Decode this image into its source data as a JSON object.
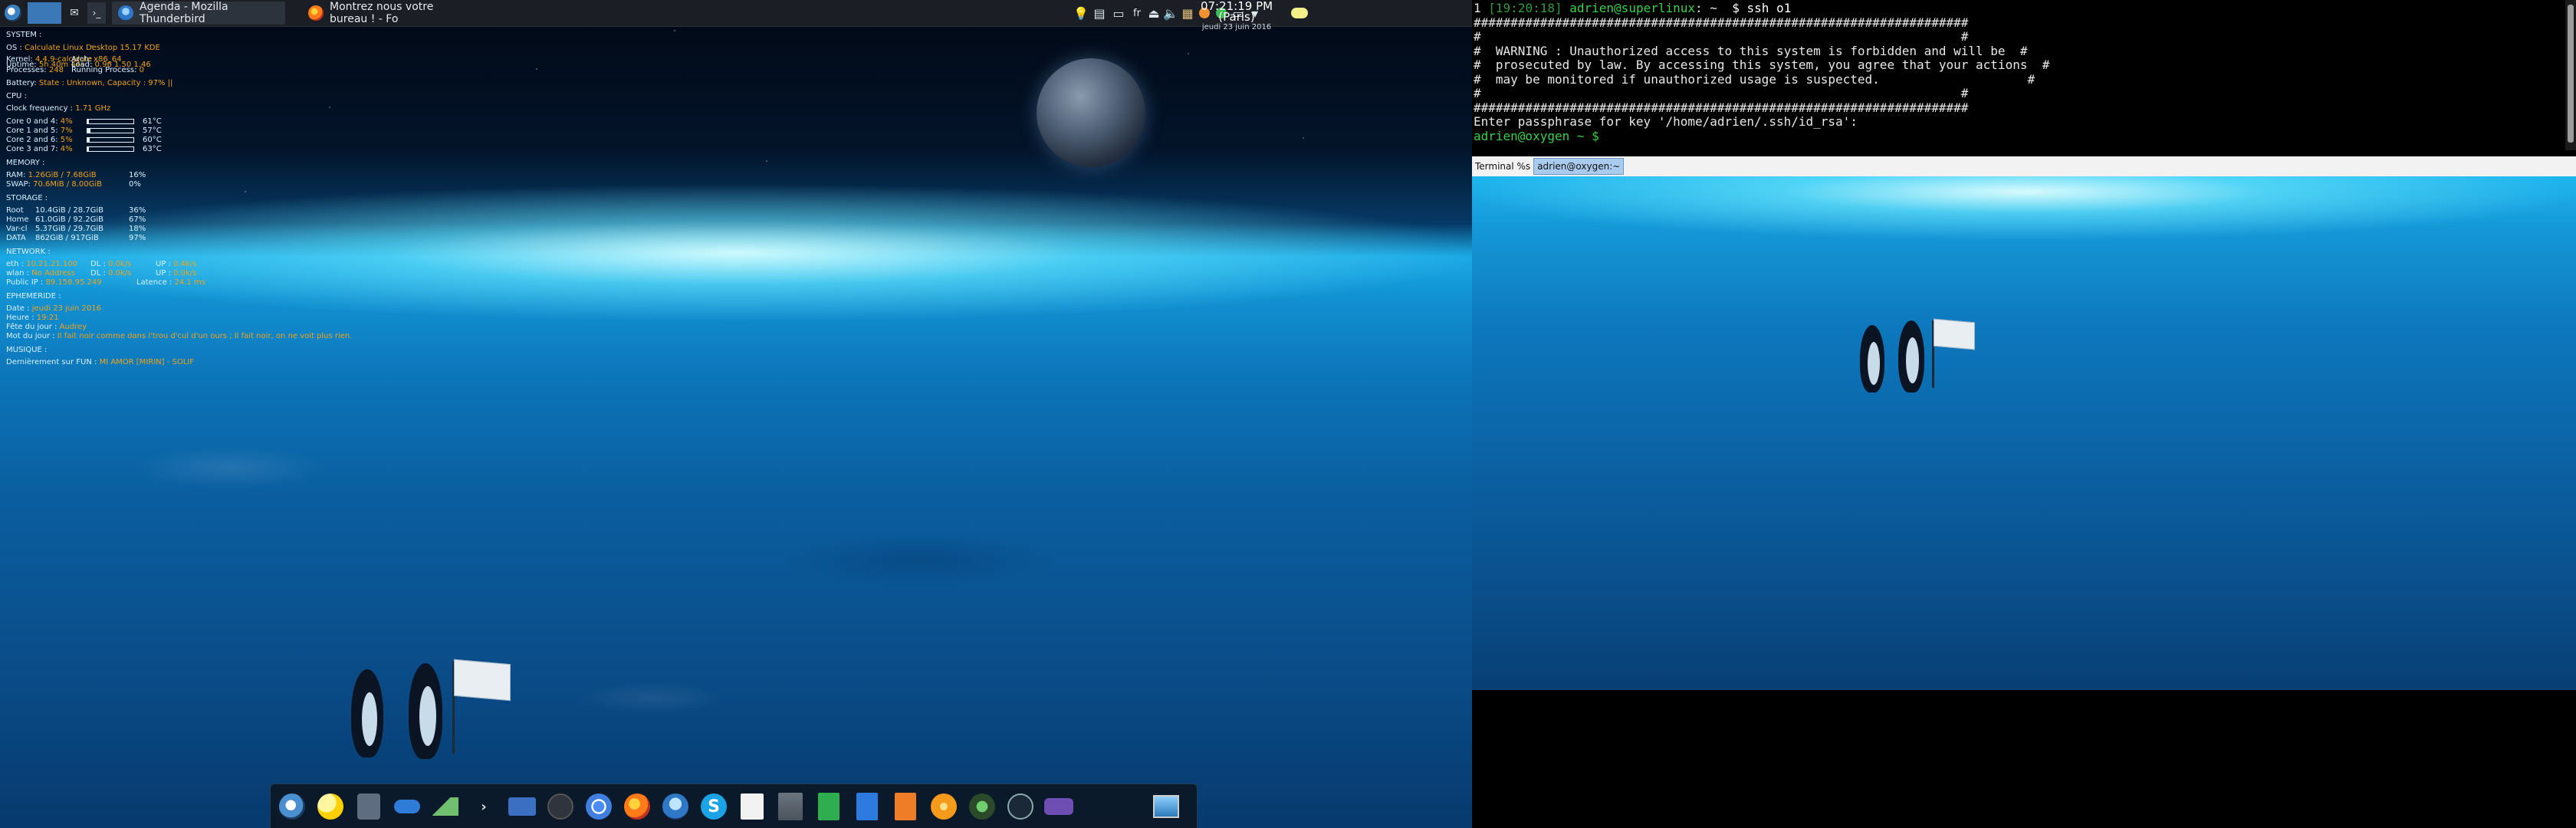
{
  "top_panel": {
    "tasks": [
      {
        "label": "Agenda - Mozilla Thunderbird"
      },
      {
        "label": "Montrez nous votre bureau ! - Fo"
      }
    ],
    "clock": {
      "time": "07:21:19 PM (Paris)",
      "date": "jeudi 23 juin 2016"
    }
  },
  "conky": {
    "system_header": "SYSTEM :",
    "os_label": "OS :",
    "os_value": "Calculate Linux Desktop 15.17 KDE",
    "kernel_label": "Kernel:",
    "kernel_value": "4.4.9-calculate",
    "arch_label": "Arch:",
    "arch_value": "x86_64",
    "uptime_label": "Uptime:",
    "uptime_value": "5h 40m 44s",
    "load_label": "Load:",
    "load_value": "0.96 1.50 1.46",
    "processes_label": "Processes:",
    "processes_value": "248",
    "running_label": "Running Process:",
    "running_value": "0",
    "battery_label": "Battery:",
    "battery_value": "State : Unknown, Capacity : 97% ||",
    "cpu_header": "CPU :",
    "clock_label": "Clock frequency :",
    "clock_value": "1.71 GHz",
    "cores": [
      {
        "label": "Core 0 and 4:",
        "pct": "4%",
        "temp": "61°C",
        "level": 0.04
      },
      {
        "label": "Core 1 and 5:",
        "pct": "7%",
        "temp": "57°C",
        "level": 0.07
      },
      {
        "label": "Core 2 and 6:",
        "pct": "5%",
        "temp": "60°C",
        "level": 0.05
      },
      {
        "label": "Core 3 and 7:",
        "pct": "4%",
        "temp": "63°C",
        "level": 0.04
      }
    ],
    "memory_header": "MEMORY :",
    "ram_label": "RAM:",
    "ram_value": "1.26GiB / 7.68GiB",
    "ram_pct": "16%",
    "swap_label": "SWAP:",
    "swap_value": "70.6MiB / 8.00GiB",
    "swap_pct": "0%",
    "storage_header": "STORAGE :",
    "storage": [
      {
        "label": "Root",
        "value": "10.4GiB / 28.7GiB",
        "pct": "36%"
      },
      {
        "label": "Home",
        "value": "61.0GiB / 92.2GiB",
        "pct": "67%"
      },
      {
        "label": "Var-cl",
        "value": "5.37GiB / 29.7GiB",
        "pct": "18%"
      },
      {
        "label": "DATA",
        "value": "862GiB / 917GiB",
        "pct": "97%"
      }
    ],
    "network_header": "NETWORK :",
    "eth_label": "eth :",
    "eth_value": "10.21.21.100",
    "eth_dl_label": "DL :",
    "eth_dl_value": "0.0k/s",
    "eth_up_label": "UP :",
    "eth_up_value": "0.4k/s",
    "wlan_label": "wlan :",
    "wlan_value": "No Address",
    "wlan_dl_label": "DL :",
    "wlan_dl_value": "0.0k/s",
    "wlan_up_label": "UP :",
    "wlan_up_value": "0.0k/s",
    "public_ip_label": "Public IP :",
    "public_ip_value": "89.158.95.249",
    "latency_label": "Latence :",
    "latency_value": "24.1 ms",
    "ephemeride_header": "EPHEMERIDE :",
    "date_label": "Date :",
    "date_value": "jeudi 23 juin 2016",
    "heure_label": "Heure :",
    "heure_value": "19:21",
    "fete_label": "Fête du jour :",
    "fete_value": "Audrey",
    "mot_label": "Mot du jour :",
    "mot_value": "Il fait noir comme dans l'trou d'cul d'un ours ; Il fait noir, on ne voit plus rien.",
    "musique_header": "MUSIQUE :",
    "fun_label": "Dernièrement sur FUN :",
    "fun_value": "MI AMOR [MIRIN] - SOLIF"
  },
  "terminal": {
    "prompt1_num": "1",
    "prompt1_time": "[19:20:18]",
    "prompt1_user": "adrien@superlinux",
    "prompt1_path": "~",
    "prompt1_cmd": "$ ssh o1",
    "banner_border": "###################################################################",
    "banner_blank": "#                                                                 #",
    "banner_line1": "#  WARNING : Unauthorized access to this system is forbidden and will be  #",
    "banner_line2": "#  prosecuted by law. By accessing this system, you agree that your actions  #",
    "banner_line3": "#  may be monitored if unauthorized usage is suspected.                    #",
    "banner_last_blank": "#                                                                 #",
    "passphrase": "Enter passphrase for key '/home/adrien/.ssh/id_rsa':",
    "prompt2": "adrien@oxygen ~ $"
  },
  "tmux": {
    "tab1": "Terminal %s",
    "tab2": "adrien@oxygen:~"
  },
  "colors": {
    "conky_value": "#f0a318",
    "prompt_green": "#35d14a"
  }
}
